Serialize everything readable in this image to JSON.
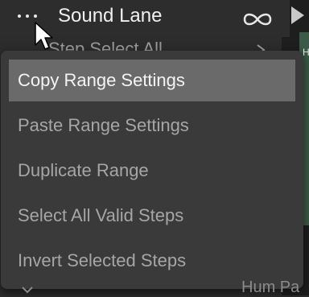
{
  "header": {
    "title": "Sound Lane"
  },
  "behind": {
    "row_text": "Step Select All",
    "right_label": "H",
    "bottom_text": "Hum Pa"
  },
  "menu": {
    "items": [
      {
        "label": "Copy Range Settings",
        "selected": true
      },
      {
        "label": "Paste Range Settings",
        "selected": false
      },
      {
        "label": "Duplicate Range",
        "selected": false
      },
      {
        "label": "Select All Valid Steps",
        "selected": false
      },
      {
        "label": "Invert Selected Steps",
        "selected": false
      }
    ]
  },
  "colors": {
    "menu_bg": "#3a3a3a",
    "selected_bg": "#6a6a6a",
    "text_enabled": "#f4f4f4",
    "text_disabled": "#a6a6a6",
    "accent_green": "#3c5a47"
  }
}
